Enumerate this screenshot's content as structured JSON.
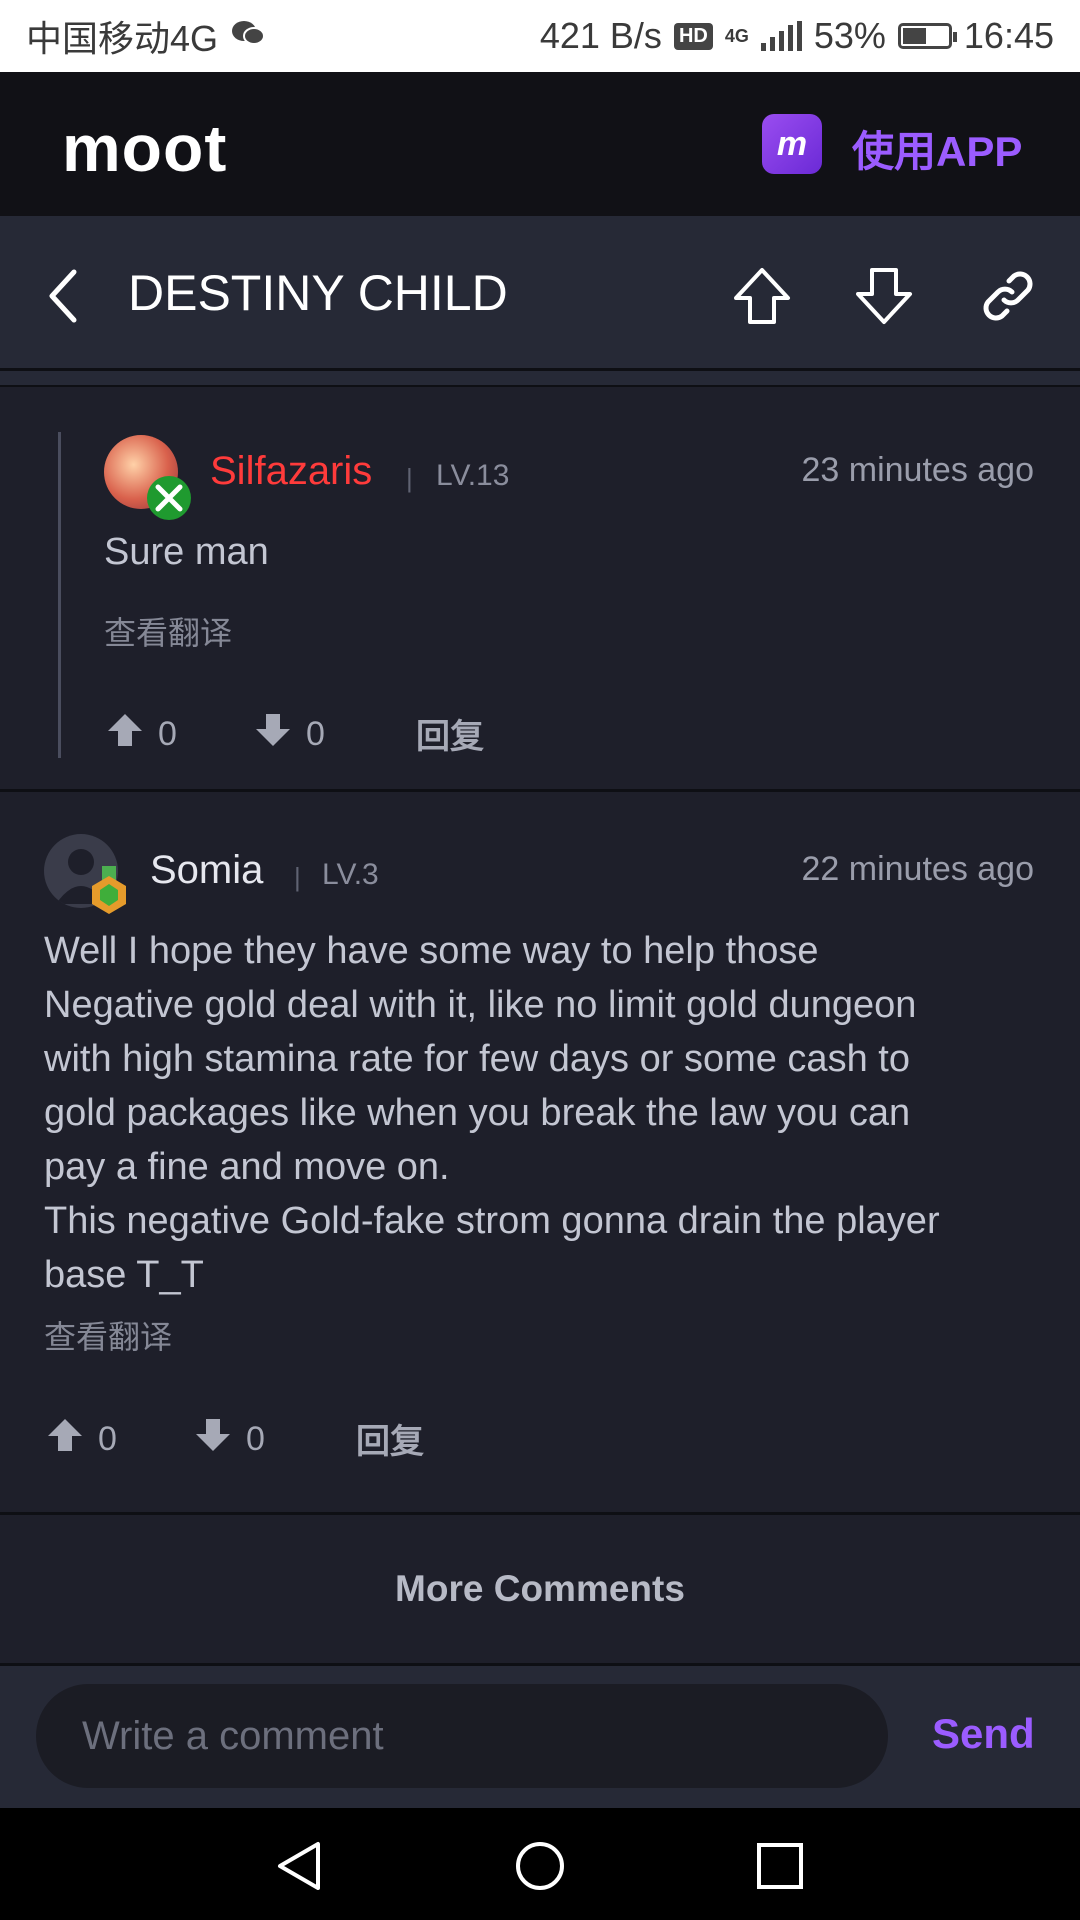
{
  "status_bar": {
    "carrier": "中国移动4G",
    "net_speed": "421 B/s",
    "hd": "HD",
    "net_type": "4G",
    "battery": "53%",
    "battery_level": 0.53,
    "time": "16:45",
    "icons": [
      "wechat-icon",
      "signal-icon",
      "battery-icon"
    ]
  },
  "app_header": {
    "logo": "moot",
    "app_icon_text": "m",
    "app_button_label": "使用APP"
  },
  "nav": {
    "title": "DESTINY CHILD",
    "icons": [
      "back-icon",
      "arrow-up-icon",
      "arrow-down-icon",
      "link-icon"
    ]
  },
  "comments": [
    {
      "username": "Silfazaris",
      "username_color": "#ff3b3b",
      "level": "LV.13",
      "time": "23 minutes ago",
      "body": "Sure man",
      "translate_label": "查看翻译",
      "upvotes": "0",
      "downvotes": "0",
      "reply_label": "回复"
    },
    {
      "username": "Somia",
      "username_color": "#e6e7ee",
      "level": "LV.3",
      "time": "22 minutes ago",
      "body_lines": [
        "Well I hope they have some way to help those",
        "Negative gold deal with it, like no limit gold dungeon",
        "with high stamina rate for few days or some cash to",
        "gold packages like when you break the law you can",
        "pay a fine and move on.",
        "This negative Gold-fake strom gonna drain the player",
        "base T_T"
      ],
      "translate_label": "查看翻译",
      "upvotes": "0",
      "downvotes": "0",
      "reply_label": "回复"
    }
  ],
  "more_comments_label": "More Comments",
  "composer": {
    "placeholder": "Write a comment",
    "send_label": "Send"
  },
  "accent_color": "#9b5cff"
}
